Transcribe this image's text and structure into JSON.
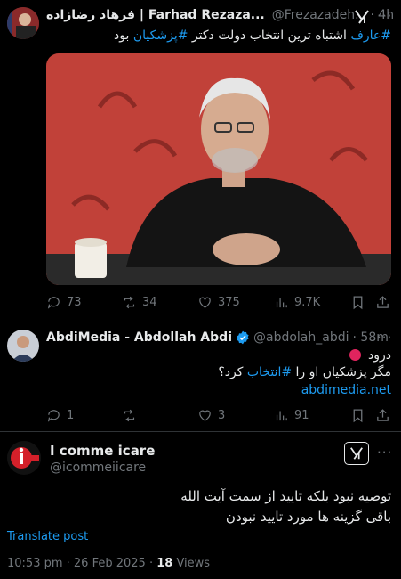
{
  "tweet1": {
    "display_name": "فرهاد رضازاده | Farhad Rezaza...",
    "handle": "@Frezazadeh...",
    "time": "· 4h",
    "text_prefix": "#عارف",
    "text_middle": " اشتباه ترین انتخاب دولت دکتر ",
    "text_tag2": "#پزشکیان",
    "text_suffix": " بود",
    "replies": "73",
    "reposts": "34",
    "likes": "375",
    "views": "9.7K"
  },
  "tweet2": {
    "display_name": "AbdiMedia - Abdollah Abdi",
    "handle": "@abdolah_abdi",
    "time": "· 58m",
    "line1": "درود",
    "line2_a": "مگر پزشکیان او را ",
    "line2_tag": "#انتخاب",
    "line2_b": " کرد؟",
    "link": "abdimedia.net",
    "replies": "1",
    "reposts": "",
    "likes": "3",
    "views": "91"
  },
  "tweet3": {
    "display_name": "I comme icare",
    "handle": "@icommeiicare",
    "line1": "توصیه نبود بلکه تایید از سمت آیت الله",
    "line2": "باقی گزینه ها مورد تایید نبودن",
    "translate": "Translate post",
    "timestamp": "10:53 pm · 26 Feb 2025 · ",
    "views_count": "18",
    "views_label": " Views"
  },
  "colors": {
    "accent": "#1d9bf0",
    "muted": "#71767b",
    "background": "#000000"
  }
}
